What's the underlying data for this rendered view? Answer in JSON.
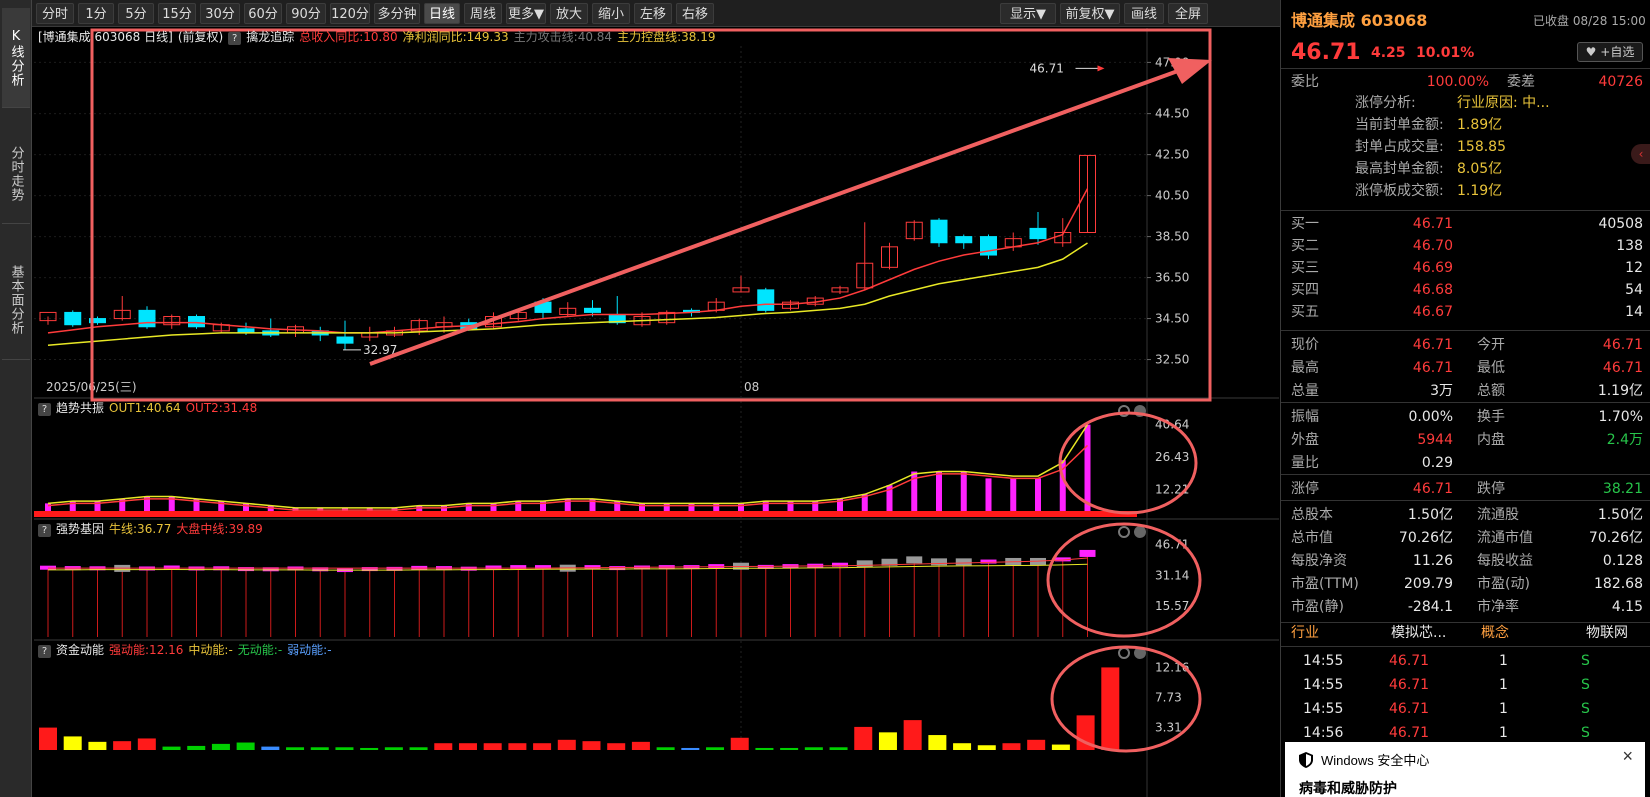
{
  "sidebar": {
    "tabs": [
      "K线分析",
      "分时走势",
      "基本面分析"
    ]
  },
  "toolbar": {
    "left": [
      "分时",
      "1分",
      "5分",
      "15分",
      "30分",
      "60分",
      "90分",
      "120分",
      "多分钟",
      "日线",
      "周线",
      "更多▼",
      "放大",
      "缩小",
      "左移",
      "右移"
    ],
    "selected": "日线",
    "right": [
      "显示▼",
      "前复权▼",
      "画线",
      "全屏"
    ]
  },
  "main_legend": {
    "title": "[博通集成 603068 日线]",
    "fq": "(前复权)",
    "indicator": "擒龙追踪",
    "items": [
      {
        "t": "总收入同比:10.80",
        "c": "#ff3b3b"
      },
      {
        "t": "净利润同比:149.33",
        "c": "#e8c33a"
      },
      {
        "t": "主力攻击线:40.84",
        "c": "#777777"
      },
      {
        "t": "主力控盘线:38.19",
        "c": "#e8c33a"
      }
    ]
  },
  "panel2_legend": {
    "name": "趋势共振",
    "items": [
      {
        "t": "OUT1:40.64",
        "c": "#e8c33a"
      },
      {
        "t": "OUT2:31.48",
        "c": "#ff3b3b"
      }
    ]
  },
  "panel3_legend": {
    "name": "强势基因",
    "items": [
      {
        "t": "牛线:36.77",
        "c": "#e8c33a"
      },
      {
        "t": "大盘中线:39.89",
        "c": "#ff3b3b"
      }
    ]
  },
  "panel4_legend": {
    "name": "资金动能",
    "items": [
      {
        "t": "强动能:12.16",
        "c": "#ff3b3b"
      },
      {
        "t": "中动能:-",
        "c": "#e8c33a"
      },
      {
        "t": "无动能:-",
        "c": "#27c44a"
      },
      {
        "t": "弱动能:-",
        "c": "#5aa0ff"
      }
    ]
  },
  "chart_data": [
    {
      "type": "candlestick",
      "name": "main",
      "y_ticks": [
        "47.00",
        "44.50",
        "42.50",
        "40.50",
        "38.50",
        "36.50",
        "34.50",
        "32.50"
      ],
      "ylim": [
        31.6,
        47.8
      ],
      "x_labels": [
        {
          "label": "2025/06/25(三)",
          "index": 0
        },
        {
          "label": "08",
          "index": 28
        }
      ],
      "last_price_label": "46.71",
      "low_label": "32.97",
      "candles": [
        [
          34.4,
          34.8,
          34.2,
          34.6
        ],
        [
          34.8,
          34.2,
          34.1,
          34.9
        ],
        [
          34.5,
          34.3,
          34.2,
          34.6
        ],
        [
          34.5,
          34.9,
          34.4,
          35.6
        ],
        [
          34.9,
          34.1,
          34.0,
          35.1
        ],
        [
          34.2,
          34.6,
          34.0,
          34.7
        ],
        [
          34.6,
          34.1,
          34.0,
          34.7
        ],
        [
          33.9,
          34.2,
          33.8,
          34.3
        ],
        [
          34.0,
          33.8,
          33.7,
          34.3
        ],
        [
          33.9,
          33.7,
          33.6,
          34.5
        ],
        [
          33.8,
          34.1,
          33.6,
          34.2
        ],
        [
          33.9,
          33.7,
          33.4,
          34.1
        ],
        [
          33.6,
          33.3,
          32.97,
          34.4
        ],
        [
          33.6,
          33.8,
          33.4,
          34.1
        ],
        [
          33.7,
          33.9,
          33.6,
          34.1
        ],
        [
          33.9,
          34.4,
          33.7,
          34.5
        ],
        [
          34.1,
          34.3,
          33.8,
          34.6
        ],
        [
          34.3,
          34.0,
          33.9,
          34.5
        ],
        [
          34.1,
          34.6,
          34.0,
          34.8
        ],
        [
          34.5,
          34.8,
          34.4,
          34.9
        ],
        [
          35.3,
          34.8,
          34.5,
          35.5
        ],
        [
          34.7,
          35.0,
          34.6,
          35.3
        ],
        [
          35.0,
          34.8,
          34.6,
          35.4
        ],
        [
          34.7,
          34.3,
          34.2,
          35.6
        ],
        [
          34.2,
          34.6,
          34.1,
          34.8
        ],
        [
          34.3,
          34.8,
          34.2,
          34.9
        ],
        [
          34.9,
          34.8,
          34.6,
          35.0
        ],
        [
          34.9,
          35.3,
          34.8,
          35.5
        ],
        [
          35.8,
          36.0,
          35.8,
          36.6
        ],
        [
          35.9,
          34.9,
          34.8,
          36.0
        ],
        [
          35.0,
          35.3,
          34.9,
          35.4
        ],
        [
          35.2,
          35.5,
          35.1,
          35.6
        ],
        [
          35.8,
          36.0,
          35.7,
          36.1
        ],
        [
          36.0,
          37.2,
          35.9,
          39.2
        ],
        [
          37.0,
          38.0,
          36.9,
          38.2
        ],
        [
          38.4,
          39.2,
          38.3,
          39.3
        ],
        [
          39.3,
          38.2,
          38.0,
          39.4
        ],
        [
          38.5,
          38.2,
          37.9,
          38.6
        ],
        [
          38.5,
          37.6,
          37.4,
          38.6
        ],
        [
          38.0,
          38.4,
          37.8,
          38.7
        ],
        [
          38.9,
          38.4,
          38.1,
          39.7
        ],
        [
          38.2,
          38.7,
          38.0,
          39.4
        ],
        [
          38.7,
          42.46,
          38.7,
          42.46
        ]
      ],
      "series": [
        {
          "name": "主力攻击线",
          "color": "#ff3b3b",
          "values": [
            33.8,
            33.95,
            34.1,
            34.2,
            34.3,
            34.3,
            34.3,
            34.2,
            34.1,
            34.0,
            33.95,
            33.9,
            33.8,
            33.8,
            33.9,
            34.0,
            34.1,
            34.15,
            34.25,
            34.35,
            34.5,
            34.6,
            34.7,
            34.7,
            34.7,
            34.75,
            34.8,
            34.9,
            35.1,
            35.2,
            35.2,
            35.3,
            35.5,
            35.9,
            36.4,
            36.9,
            37.3,
            37.6,
            37.8,
            38.0,
            38.2,
            38.6,
            40.84
          ]
        },
        {
          "name": "主力控盘线",
          "color": "#e8e825",
          "values": [
            33.2,
            33.3,
            33.4,
            33.5,
            33.6,
            33.7,
            33.75,
            33.8,
            33.8,
            33.8,
            33.8,
            33.8,
            33.8,
            33.8,
            33.8,
            33.85,
            33.9,
            33.95,
            34.0,
            34.1,
            34.2,
            34.25,
            34.3,
            34.35,
            34.4,
            34.45,
            34.5,
            34.55,
            34.65,
            34.75,
            34.8,
            34.9,
            35.0,
            35.2,
            35.6,
            35.9,
            36.2,
            36.4,
            36.6,
            36.8,
            37.0,
            37.4,
            38.19
          ]
        }
      ]
    },
    {
      "type": "bar",
      "name": "趋势共振",
      "y_ticks": [
        "40.64",
        "26.43",
        "12.21"
      ],
      "ylim": [
        0,
        44
      ],
      "values": [
        6,
        7,
        7,
        8,
        9,
        9,
        8,
        7,
        6,
        5,
        4,
        4,
        4,
        4,
        4,
        5,
        5,
        6,
        6,
        7,
        7,
        8,
        8,
        7,
        6,
        6,
        6,
        6,
        6,
        7,
        7,
        7,
        8,
        10,
        14,
        20,
        20,
        20,
        17,
        17,
        17,
        25,
        40.64
      ],
      "line1": [
        6,
        7,
        7,
        8,
        9,
        9,
        8,
        7,
        6,
        5,
        4,
        4,
        4,
        4,
        4,
        5,
        5,
        6,
        6,
        7,
        7,
        8,
        8,
        7,
        6,
        6,
        6,
        6,
        6,
        7,
        7,
        7,
        8,
        10,
        14,
        19,
        20,
        20,
        19,
        18,
        18,
        24,
        40.64
      ],
      "line2": [
        5,
        6,
        6,
        7,
        8,
        8,
        7,
        6,
        5,
        4,
        3,
        3,
        3,
        3,
        3,
        4,
        4,
        5,
        5,
        6,
        6,
        7,
        7,
        6,
        5,
        5,
        5,
        5,
        5,
        6,
        6,
        6,
        7,
        9,
        12,
        17,
        19,
        19,
        18,
        17,
        17,
        21,
        31.48
      ]
    },
    {
      "type": "bar",
      "name": "强势基因",
      "y_ticks": [
        "46.71",
        "31.14",
        "15.57"
      ],
      "ylim": [
        0,
        50
      ],
      "values": [
        34.5,
        34.3,
        34.2,
        34.9,
        34.1,
        34.6,
        34.1,
        34.2,
        33.8,
        33.7,
        34.1,
        33.7,
        33.3,
        33.8,
        33.9,
        34.4,
        34.3,
        34.0,
        34.6,
        34.8,
        34.8,
        35.0,
        34.8,
        34.3,
        34.6,
        34.8,
        34.8,
        35.3,
        36.0,
        34.9,
        35.3,
        35.5,
        36.0,
        37.2,
        38.0,
        39.2,
        38.2,
        38.2,
        37.6,
        38.4,
        38.4,
        38.7,
        42.46
      ],
      "line1": [
        33.9,
        33.9,
        34.0,
        34.0,
        34.0,
        34.1,
        34.0,
        34.0,
        33.9,
        33.9,
        33.9,
        33.8,
        33.8,
        33.8,
        33.8,
        33.9,
        33.9,
        34.0,
        34.0,
        34.1,
        34.2,
        34.3,
        34.3,
        34.3,
        34.4,
        34.4,
        34.5,
        34.6,
        34.7,
        34.7,
        34.8,
        34.9,
        35.0,
        35.2,
        35.4,
        35.6,
        35.8,
        35.9,
        36.0,
        36.1,
        36.2,
        36.4,
        36.77
      ],
      "line2": [
        34.8,
        34.8,
        34.8,
        34.8,
        34.8,
        34.8,
        34.8,
        34.8,
        34.8,
        34.8,
        34.8,
        34.8,
        34.8,
        34.8,
        34.8,
        34.8,
        34.8,
        34.8,
        34.8,
        34.8,
        34.8,
        34.9,
        35.0,
        35.1,
        35.2,
        35.3,
        35.4,
        35.5,
        35.6,
        35.7,
        35.8,
        35.9,
        36.0,
        36.2,
        36.5,
        36.8,
        37.1,
        37.4,
        37.7,
        38.0,
        38.3,
        38.9,
        39.89
      ]
    },
    {
      "type": "bar",
      "name": "资金动能",
      "y_ticks": [
        "12.16",
        "7.73",
        "3.31"
      ],
      "ylim": [
        0,
        13.4
      ],
      "values": [
        3.3,
        2.0,
        1.2,
        1.3,
        1.7,
        -0.5,
        -0.6,
        -0.9,
        -1.1,
        -0.5,
        -0.4,
        -0.4,
        -0.4,
        -0.3,
        -0.4,
        -0.4,
        1.0,
        1.0,
        1.0,
        1.0,
        1.0,
        1.5,
        1.3,
        1.0,
        1.2,
        -0.4,
        -0.3,
        -0.4,
        1.8,
        -0.3,
        -0.3,
        -0.4,
        -0.4,
        3.4,
        2.6,
        4.4,
        2.2,
        1.0,
        0.7,
        1.0,
        1.5,
        0.8,
        5.1,
        12.16
      ],
      "colors": [
        "r",
        "y",
        "y",
        "r",
        "r",
        "g",
        "g",
        "g",
        "g",
        "b",
        "g",
        "g",
        "g",
        "g",
        "g",
        "g",
        "r",
        "r",
        "r",
        "r",
        "r",
        "r",
        "r",
        "r",
        "r",
        "g",
        "b",
        "g",
        "r",
        "g",
        "g",
        "g",
        "g",
        "r",
        "y",
        "r",
        "y",
        "y",
        "y",
        "r",
        "r",
        "y",
        "r",
        "r"
      ]
    }
  ],
  "right_panel": {
    "name": "博通集成",
    "code": "603068",
    "status": "已收盘 08/28 15:00",
    "price": "46.71",
    "change": "4.25",
    "pct": "10.01%",
    "watch": "+自选",
    "weibi_label": "委比",
    "weibi": "100.00%",
    "weicha_label": "委差",
    "weicha": "40726",
    "limit_analysis": [
      {
        "k": "涨停分析:",
        "v": "行业原因: 中...",
        "vc": "yellow"
      },
      {
        "k": "当前封单金额:",
        "v": "1.89亿",
        "vc": "yellow"
      },
      {
        "k": "封单占成交量:",
        "v": "158.85",
        "vc": "yellow"
      },
      {
        "k": "最高封单金额:",
        "v": "8.05亿",
        "vc": "yellow"
      },
      {
        "k": "涨停板成交额:",
        "v": "1.19亿",
        "vc": "yellow"
      }
    ],
    "bids": [
      {
        "k": "买一",
        "p": "46.71",
        "v": "40508"
      },
      {
        "k": "买二",
        "p": "46.70",
        "v": "138"
      },
      {
        "k": "买三",
        "p": "46.69",
        "v": "12"
      },
      {
        "k": "买四",
        "p": "46.68",
        "v": "54"
      },
      {
        "k": "买五",
        "p": "46.67",
        "v": "14"
      }
    ],
    "quote": [
      [
        {
          "k": "现价",
          "v": "46.71",
          "c": "red"
        },
        {
          "k": "今开",
          "v": "46.71",
          "c": "red"
        }
      ],
      [
        {
          "k": "最高",
          "v": "46.71",
          "c": "red"
        },
        {
          "k": "最低",
          "v": "46.71",
          "c": "red"
        }
      ],
      [
        {
          "k": "总量",
          "v": "3万",
          "c": "white"
        },
        {
          "k": "总额",
          "v": "1.19亿",
          "c": "white"
        }
      ]
    ],
    "quote2": [
      [
        {
          "k": "振幅",
          "v": "0.00%",
          "c": "white"
        },
        {
          "k": "换手",
          "v": "1.70%",
          "c": "white"
        }
      ],
      [
        {
          "k": "外盘",
          "v": "5944",
          "c": "red"
        },
        {
          "k": "内盘",
          "v": "2.4万",
          "c": "green"
        }
      ],
      [
        {
          "k": "量比",
          "v": "0.29",
          "c": "white"
        },
        {
          "k": "",
          "v": "",
          "c": "white"
        }
      ]
    ],
    "quote3": [
      [
        {
          "k": "涨停",
          "v": "46.71",
          "c": "red"
        },
        {
          "k": "跌停",
          "v": "38.21",
          "c": "green"
        }
      ]
    ],
    "finance": [
      [
        {
          "k": "总股本",
          "v": "1.50亿"
        },
        {
          "k": "流通股",
          "v": "1.50亿"
        }
      ],
      [
        {
          "k": "总市值",
          "v": "70.26亿"
        },
        {
          "k": "流通市值",
          "v": "70.26亿"
        }
      ],
      [
        {
          "k": "每股净资",
          "v": "11.26"
        },
        {
          "k": "每股收益",
          "v": "0.128"
        }
      ],
      [
        {
          "k": "市盈(TTM)",
          "v": "209.79"
        },
        {
          "k": "市盈(动)",
          "v": "182.68"
        }
      ],
      [
        {
          "k": "市盈(静)",
          "v": "-284.1"
        },
        {
          "k": "市净率",
          "v": "4.15"
        }
      ]
    ],
    "industry": {
      "k1": "行业",
      "v1": "模拟芯...",
      "k2": "概念",
      "v2": "物联网"
    },
    "ticks": [
      {
        "t": "14:55",
        "p": "46.71",
        "v": "1",
        "d": "S"
      },
      {
        "t": "14:55",
        "p": "46.71",
        "v": "1",
        "d": "S"
      },
      {
        "t": "14:55",
        "p": "46.71",
        "v": "1",
        "d": "S"
      },
      {
        "t": "14:56",
        "p": "46.71",
        "v": "1",
        "d": "S"
      }
    ]
  },
  "popup": {
    "title": "Windows 安全中心",
    "close": "×",
    "body": "病毒和威胁防护"
  }
}
